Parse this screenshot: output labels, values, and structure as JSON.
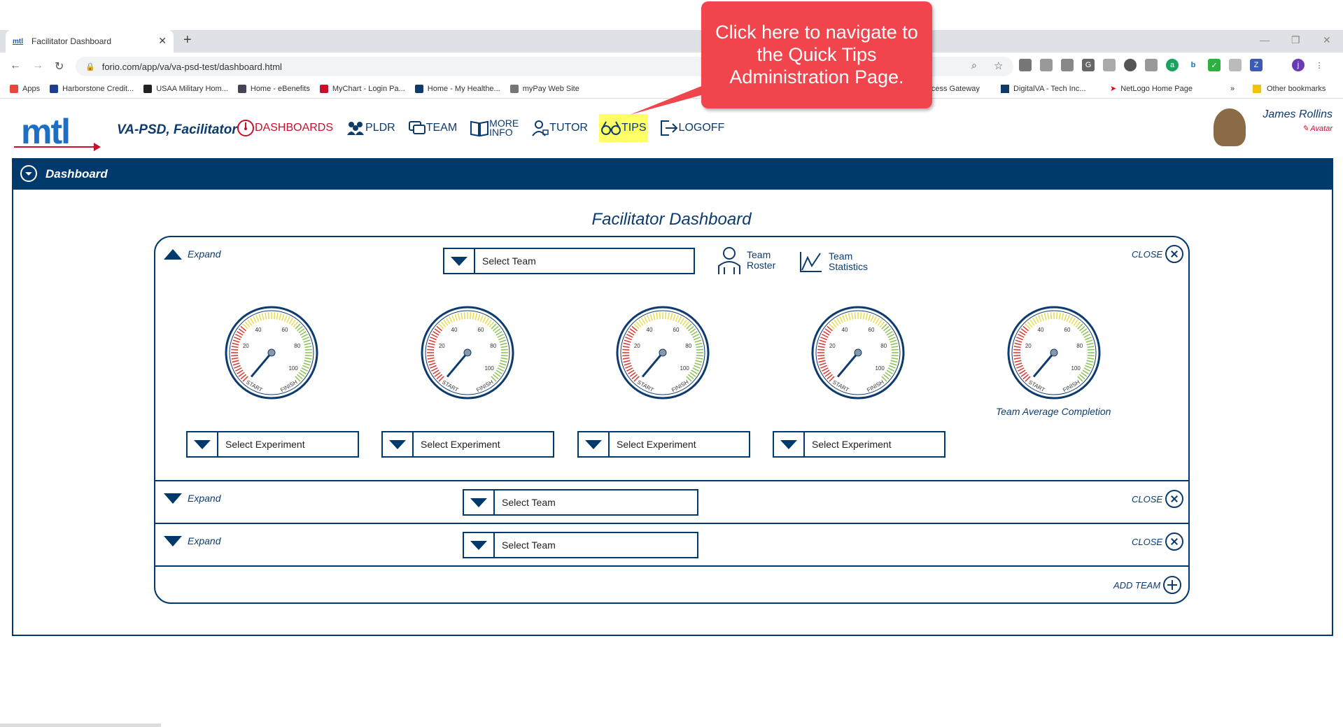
{
  "browser": {
    "tab_title": "Facilitator Dashboard",
    "tab_favicon": "mtl",
    "url": "forio.com/app/va/va-psd-test/dashboard.html",
    "bookmarks": [
      "Apps",
      "Harborstone Credit...",
      "USAA Military Hom...",
      "Home - eBenefits",
      "MyChart - Login Pa...",
      "Home - My Healthe...",
      "myPay Web Site"
    ],
    "bookmarks_right": [
      "Access Gateway",
      "DigitalVA - Tech Inc...",
      "NetLogo Home Page"
    ],
    "overflow": "»",
    "other_bookmarks": "Other bookmarks",
    "profile_initial": "j"
  },
  "app": {
    "logo": "mtl",
    "title": "VA-PSD, Facilitator",
    "nav": [
      {
        "label": "DASHBOARDS",
        "icon": "dashboard-gauge-icon"
      },
      {
        "label": "PLDR",
        "icon": "people-group-icon"
      },
      {
        "label": "TEAM",
        "icon": "chat-bubbles-icon"
      },
      {
        "label": "MORE",
        "label2": "INFO",
        "icon": "open-book-icon"
      },
      {
        "label": "TUTOR",
        "icon": "tutor-person-icon"
      },
      {
        "label": "TIPS",
        "icon": "glasses-icon"
      },
      {
        "label": "LOGOFF",
        "icon": "logoff-arrow-icon"
      }
    ],
    "user_name": "James Rollins",
    "user_sub": "Avatar"
  },
  "dashboard": {
    "panel_label": "Dashboard",
    "title": "Facilitator Dashboard",
    "expand_label": "Expand",
    "close_label": "CLOSE",
    "select_team": "Select Team",
    "team_roster": [
      "Team",
      "Roster"
    ],
    "team_statistics": [
      "Team",
      "Statistics"
    ],
    "select_experiment": "Select Experiment",
    "team_average": "Team Average Completion",
    "add_team": "ADD TEAM",
    "gauge_labels": [
      "20",
      "40",
      "60",
      "80",
      "100",
      "START",
      "FINISH"
    ]
  },
  "callout": {
    "line1": "Click here to navigate to",
    "line2": "the Quick Tips",
    "line3": "Administration Page."
  }
}
